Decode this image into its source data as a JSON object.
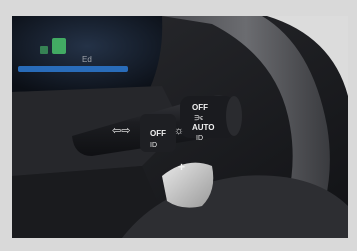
{
  "photo": {
    "colors": {
      "frame": "#d9d9d9",
      "stalk": "#1f2024",
      "label": "#f2f2f2",
      "cluster_blue": "#2b74c9",
      "cluster_green": "#49c26b"
    },
    "cluster_text": "Ed",
    "stalk_labels": {
      "arrows_icon": "turn-signal-arrows-icon",
      "off_inner": "OFF",
      "headlight_inner_icon": "headlight-icon",
      "sun_icon": "parking-light-icon",
      "off_outer": "OFF",
      "parking_icon": "sidelight-icon",
      "auto": "AUTO",
      "low_beam_icon": "low-beam-icon"
    },
    "paddle_label": "+"
  }
}
